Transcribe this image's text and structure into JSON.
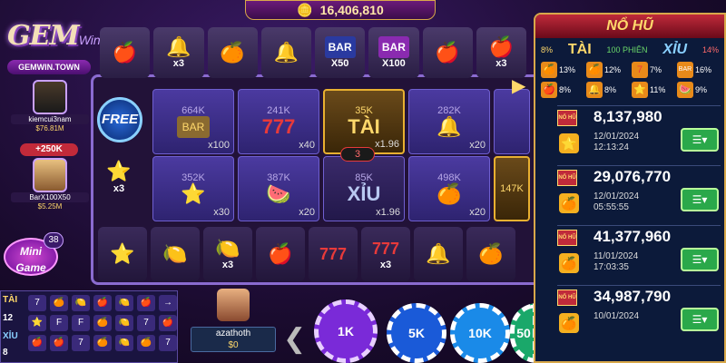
{
  "header": {
    "balance": "16,406,810"
  },
  "logo": {
    "text": "GEM",
    "sub": "Win",
    "site": "GEMWIN.TOWN"
  },
  "players": [
    {
      "name": "kiemcui3nam",
      "money": "$76.81M"
    },
    {
      "name": "BarX100X50",
      "money": "$5.25M"
    }
  ],
  "win_badge": "+250K",
  "top_row": [
    {
      "sym": "🍎",
      "label": ""
    },
    {
      "sym": "🔔",
      "label": "x3"
    },
    {
      "sym": "🍊",
      "label": ""
    },
    {
      "sym": "🔔",
      "label": ""
    },
    {
      "sym": "BAR",
      "label": "X50"
    },
    {
      "sym": "BAR",
      "label": "X100"
    },
    {
      "sym": "🍎",
      "label": ""
    },
    {
      "sym": "🍎",
      "label": "x3"
    }
  ],
  "free_label": "FREE",
  "star_mult": "x3",
  "reel_row1": [
    {
      "k": "664K",
      "sym": "BAR",
      "m": "x100"
    },
    {
      "k": "241K",
      "sym": "777",
      "m": "x40"
    },
    {
      "k": "35K",
      "sym": "TÀI",
      "m": "x1.96"
    },
    {
      "k": "282K",
      "sym": "🔔",
      "m": "x20"
    }
  ],
  "reel_row2": [
    {
      "k": "352K",
      "sym": "⭐",
      "m": "x30"
    },
    {
      "k": "387K",
      "sym": "🍉",
      "m": "x20"
    },
    {
      "k": "85K",
      "sym": "XỈU",
      "m": "x1.96"
    },
    {
      "k": "498K",
      "sym": "🍊",
      "m": "x20"
    }
  ],
  "right_partial": {
    "k": "147K"
  },
  "center_counter": "3",
  "bottom_row": [
    {
      "sym": "⭐",
      "label": ""
    },
    {
      "sym": "🍋",
      "label": ""
    },
    {
      "sym": "🍋",
      "label": "x3"
    },
    {
      "sym": "🍎",
      "label": ""
    },
    {
      "sym": "777",
      "label": ""
    },
    {
      "sym": "777",
      "label": "x3"
    },
    {
      "sym": "🔔",
      "label": ""
    },
    {
      "sym": "🍊",
      "label": ""
    }
  ],
  "mini_game": {
    "label": "Mini Game",
    "count": "38"
  },
  "mini_panel": {
    "tai": "TÀI",
    "tai_n": "12",
    "xiu": "XỈU",
    "xiu_n": "8"
  },
  "me": {
    "name": "azathoth",
    "money": "$0"
  },
  "chips": [
    "1K",
    "5K",
    "10K",
    "50"
  ],
  "panel": {
    "title": "NỔ HŨ",
    "tai_pct": "8%",
    "tai": "TÀI",
    "sessions": "100 PHIÊN",
    "xiu": "XỈU",
    "xiu_pct": "14%",
    "stats": [
      {
        "sym": "🍊",
        "pct": "13%"
      },
      {
        "sym": "🍊",
        "pct": "12%"
      },
      {
        "sym": "7",
        "pct": "7%"
      },
      {
        "sym": "BAR",
        "pct": "16%"
      },
      {
        "sym": "🍎",
        "pct": "8%"
      },
      {
        "sym": "🔔",
        "pct": "8%"
      },
      {
        "sym": "⭐",
        "pct": "11%"
      },
      {
        "sym": "🍉",
        "pct": "9%"
      }
    ],
    "badge": "NỔ HŨ",
    "jackpots": [
      {
        "amount": "8,137,980",
        "date": "12/01/2024",
        "time": "12:13:24",
        "icon": "⭐"
      },
      {
        "amount": "29,076,770",
        "date": "12/01/2024",
        "time": "05:55:55",
        "icon": "🍊"
      },
      {
        "amount": "41,377,960",
        "date": "11/01/2024",
        "time": "17:03:35",
        "icon": "🍊"
      },
      {
        "amount": "34,987,790",
        "date": "10/01/2024",
        "time": "",
        "icon": "🍊"
      }
    ]
  }
}
